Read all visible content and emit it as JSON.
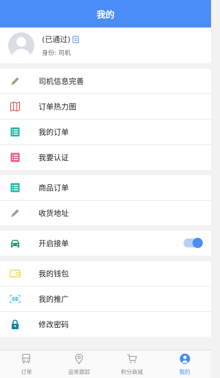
{
  "header": {
    "title": "我的"
  },
  "profile": {
    "status": "(已通过)",
    "role": "身份: 司机"
  },
  "groups": [
    [
      {
        "label": "司机信息完善",
        "icon": "pencil-icon"
      },
      {
        "label": "订单热力图",
        "icon": "map-icon"
      },
      {
        "label": "我的订单",
        "icon": "list-icon"
      },
      {
        "label": "我要认证",
        "icon": "list-icon"
      }
    ],
    [
      {
        "label": "商品订单",
        "icon": "list-icon"
      },
      {
        "label": "收货地址",
        "icon": "pencil-icon"
      }
    ],
    [
      {
        "label": "开启接单",
        "icon": "car-icon",
        "toggle_on": true
      }
    ],
    [
      {
        "label": "我的钱包",
        "icon": "wallet-icon"
      },
      {
        "label": "我的推广",
        "icon": "barcode-icon"
      },
      {
        "label": "修改密码",
        "icon": "lock-icon"
      }
    ]
  ],
  "tabbar": [
    {
      "label": "订单",
      "icon": "bus-icon"
    },
    {
      "label": "运单跟踪",
      "icon": "location-pin-icon"
    },
    {
      "label": "积分商城",
      "icon": "cart-icon"
    },
    {
      "label": "我的",
      "icon": "user-icon",
      "active": true
    }
  ],
  "colors": {
    "accent": "#4a8df8",
    "teal": "#1bb5a6",
    "pink": "#e8548c",
    "yellow": "#f2d22c",
    "cyan": "#2fb3e0",
    "lock": "#0a87a8"
  }
}
